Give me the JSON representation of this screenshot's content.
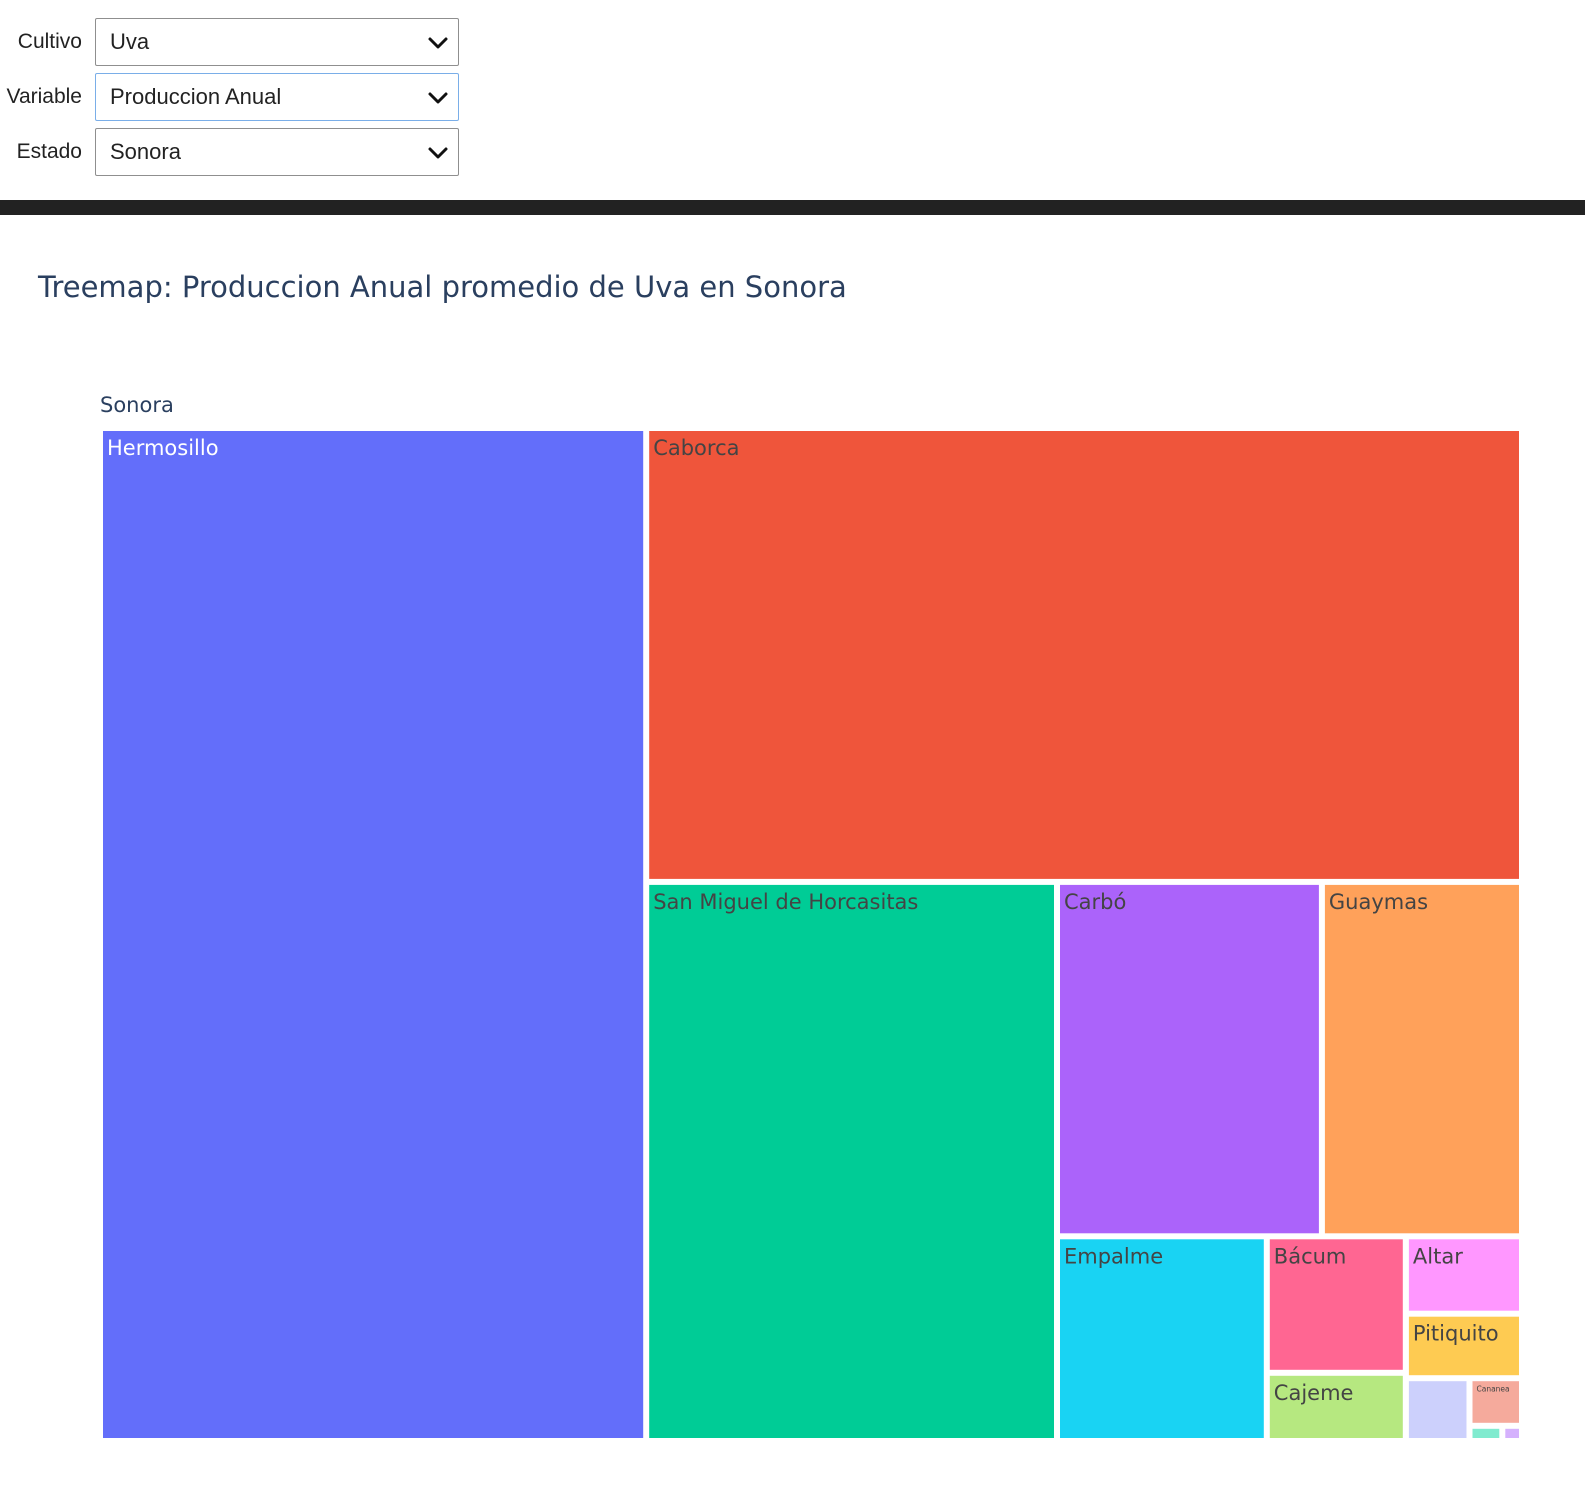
{
  "controls": {
    "cultivo": {
      "label": "Cultivo",
      "value": "Uva"
    },
    "variable": {
      "label": "Variable",
      "value": "Produccion Anual"
    },
    "estado": {
      "label": "Estado",
      "value": "Sonora"
    }
  },
  "icons": {
    "dropdown": "chevron-down-icon"
  },
  "chart_data": {
    "type": "treemap",
    "title": "Treemap: Produccion Anual promedio de Uva en Sonora",
    "root": "Sonora",
    "items": [
      {
        "name": "Hermosillo",
        "value": 554,
        "color": "#636efa",
        "text_color": "#ffffff"
      },
      {
        "name": "Caborca",
        "value": 398,
        "color": "#ef553b",
        "text_color": "#444444"
      },
      {
        "name": "San Miguel de Horcasitas",
        "value": 230,
        "color": "#00cc96",
        "text_color": "#444444"
      },
      {
        "name": "Carbó",
        "value": 94,
        "color": "#ab63fa",
        "text_color": "#444444"
      },
      {
        "name": "Guaymas",
        "value": 71,
        "color": "#ffa15a",
        "text_color": "#444444"
      },
      {
        "name": "Empalme",
        "value": 43,
        "color": "#19d3f3",
        "text_color": "#444444"
      },
      {
        "name": "Bácum",
        "value": 19,
        "color": "#ff6692",
        "text_color": "#444444"
      },
      {
        "name": "Cajeme",
        "value": 9.5,
        "color": "#b6e880",
        "text_color": "#444444"
      },
      {
        "name": "Altar",
        "value": 9,
        "color": "#ff97ff",
        "text_color": "#444444"
      },
      {
        "name": "Pitiquito",
        "value": 7.5,
        "color": "#fecb52",
        "text_color": "#444444"
      },
      {
        "name": "",
        "value": 4,
        "color": "#ccd0fc",
        "text_color": "#444444"
      },
      {
        "name": "Cananea",
        "value": 2.5,
        "color": "#f5aa9c",
        "text_color": "#444444"
      },
      {
        "name": "",
        "value": 0.5,
        "color": "#80ebcf",
        "text_color": "#444444"
      },
      {
        "name": "",
        "value": 0.3,
        "color": "#d5b1fd",
        "text_color": "#444444"
      }
    ]
  }
}
